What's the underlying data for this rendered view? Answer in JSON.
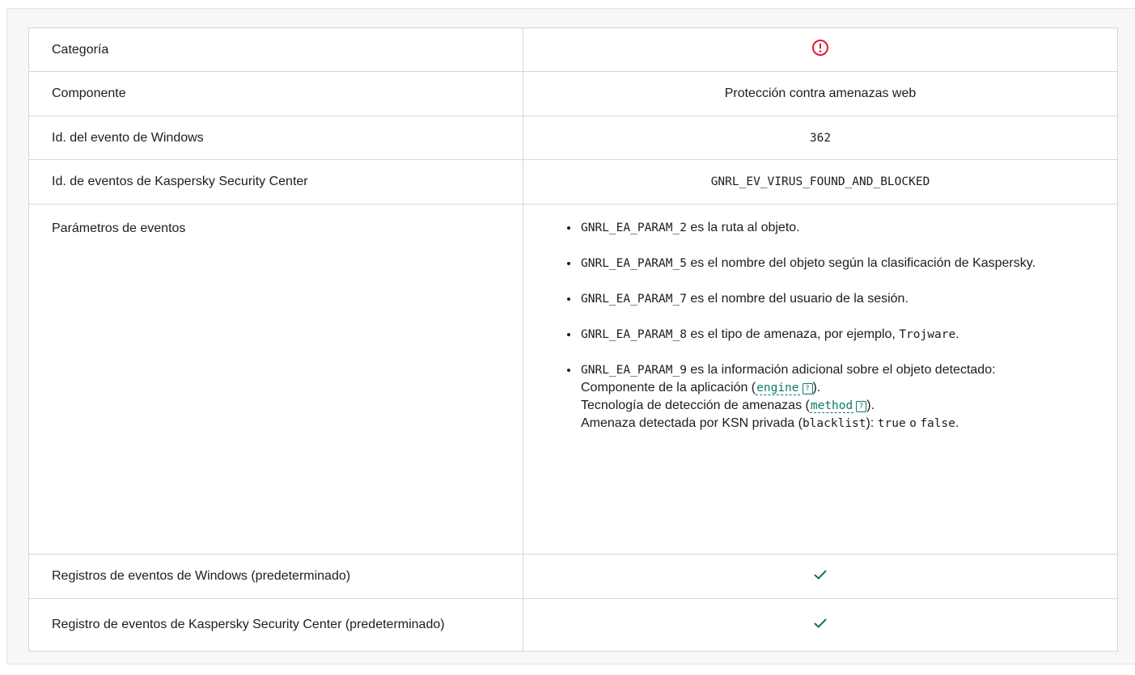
{
  "rows": {
    "categoria": {
      "label": "Categoría",
      "icon": "alert-circle-icon",
      "icon_color": "#e8172d"
    },
    "componente": {
      "label": "Componente",
      "value": "Protección contra amenazas web"
    },
    "windows_id": {
      "label": "Id. del evento de Windows",
      "value": "362"
    },
    "ksc_id": {
      "label": "Id. de eventos de Kaspersky Security Center",
      "value": "GNRL_EV_VIRUS_FOUND_AND_BLOCKED"
    },
    "params": {
      "label": "Parámetros de eventos",
      "items": [
        {
          "code": "GNRL_EA_PARAM_2",
          "text": "es la ruta al objeto."
        },
        {
          "code": "GNRL_EA_PARAM_5",
          "text": "es el nombre del objeto según la clasificación de Kaspersky."
        },
        {
          "code": "GNRL_EA_PARAM_7",
          "text": "es el nombre del usuario de la sesión."
        },
        {
          "code": "GNRL_EA_PARAM_8",
          "text": "es el tipo de amenaza, por ejemplo,",
          "example": "Trojware",
          "end": "."
        },
        {
          "code": "GNRL_EA_PARAM_9",
          "text": "es la información adicional sobre el objeto detectado:",
          "line1_text": "Componente de la aplicación (",
          "line1_link": "engine",
          "line1_end": ").",
          "line2_text": "Tecnología de detección de amenazas (",
          "line2_link": "method",
          "line2_end": ").",
          "line3_text": "Amenaza detectada por KSN privada (",
          "line3_code": "blacklist",
          "line3_mid": "):",
          "line3_true": "true",
          "line3_or": "o",
          "line3_false": "false",
          "line3_end": "."
        }
      ]
    },
    "win_log": {
      "label": "Registros de eventos de Windows (predeterminado)",
      "icon": "checkmark-icon"
    },
    "ksc_log": {
      "label": "Registro de eventos de Kaspersky Security Center (predeterminado)",
      "icon": "checkmark-icon"
    }
  },
  "help_glyph": "?",
  "colors": {
    "check": "#11706b",
    "link": "#0a7b6c",
    "alert": "#e8172d"
  }
}
